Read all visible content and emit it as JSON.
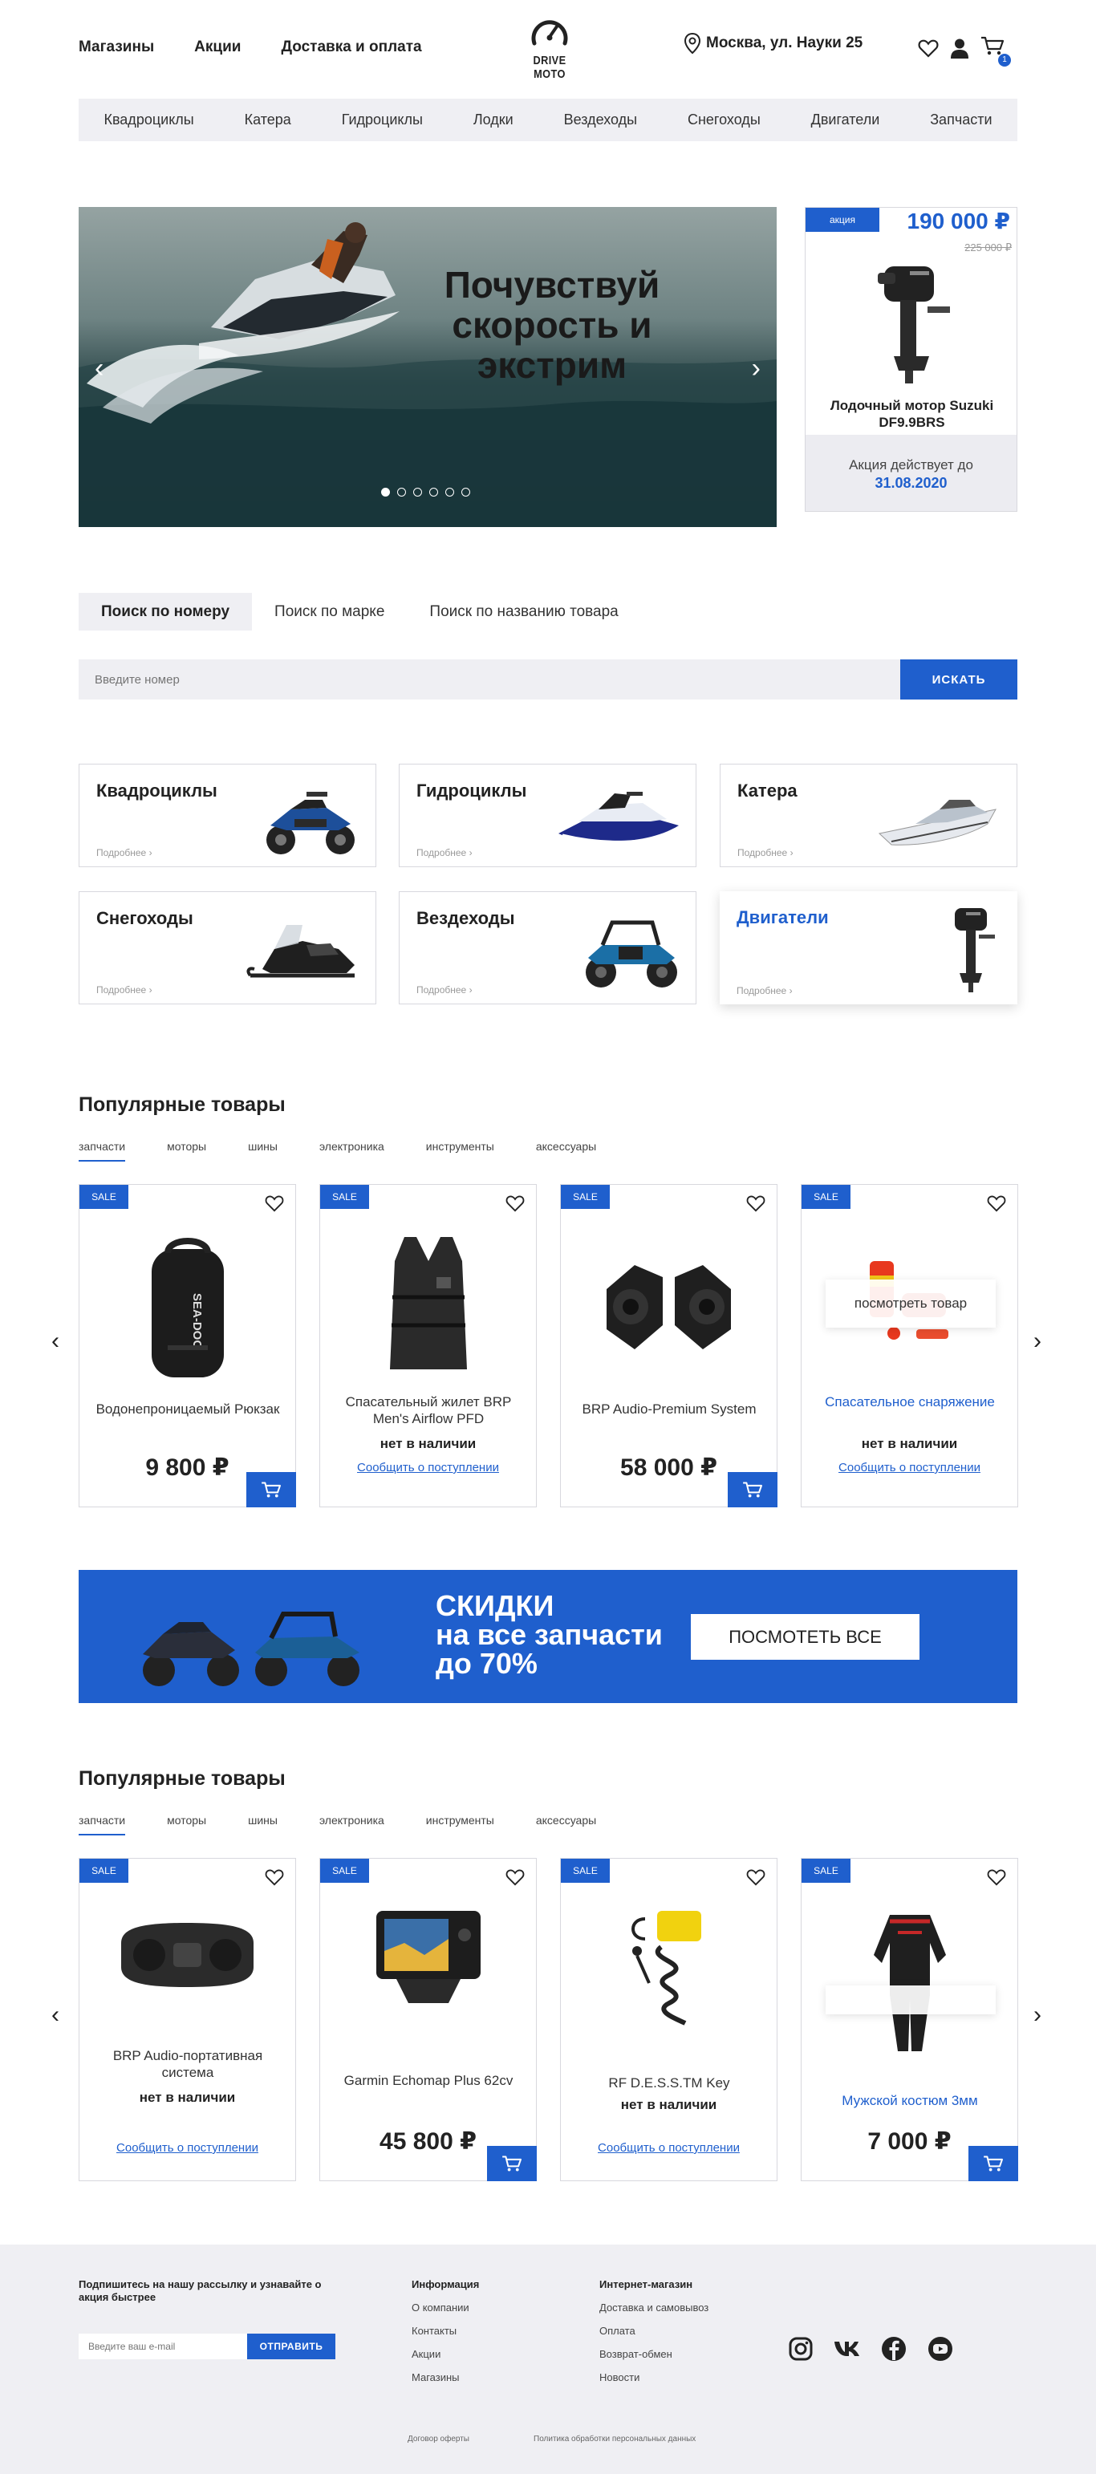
{
  "header": {
    "nav": [
      "Магазины",
      "Акции",
      "Доставка и оплата"
    ],
    "logo_text": "DRIVE MOTO",
    "address": "Москва, ул. Науки 25",
    "cart_count": "1"
  },
  "categories_bar": [
    "Квадроциклы",
    "Катера",
    "Гидроциклы",
    "Лодки",
    "Вездеходы",
    "Снегоходы",
    "Двигатели",
    "Запчасти"
  ],
  "hero": {
    "title_line1": "Почувствуй",
    "title_line2": "скорость и",
    "title_line3": "экстрим",
    "slides": 6,
    "active_slide": 1
  },
  "promo": {
    "badge": "акция",
    "price": "190 000 ₽",
    "old_price": "225 000 ₽",
    "name": "Лодочный мотор Suzuki DF9.9BRS",
    "valid_label": "Акция действует до",
    "valid_date": "31.08.2020"
  },
  "search": {
    "tabs": [
      "Поиск по номеру",
      "Поиск по марке",
      "Поиск по названию товара"
    ],
    "active_tab": 0,
    "placeholder": "Введите номер",
    "button": "ИСКАТЬ"
  },
  "category_cards": [
    {
      "name": "Квадроциклы",
      "more": "Подробнее",
      "highlighted": false,
      "icon": "atv-icon"
    },
    {
      "name": "Гидроциклы",
      "more": "Подробнее",
      "highlighted": false,
      "icon": "jetski-icon"
    },
    {
      "name": "Катера",
      "more": "Подробнее",
      "highlighted": false,
      "icon": "boat-icon"
    },
    {
      "name": "Снегоходы",
      "more": "Подробнее",
      "highlighted": false,
      "icon": "snowmobile-icon"
    },
    {
      "name": "Вездеходы",
      "more": "Подробнее",
      "highlighted": false,
      "icon": "buggy-icon"
    },
    {
      "name": "Двигатели",
      "more": "Подробнее",
      "highlighted": true,
      "icon": "outboard-motor-icon"
    }
  ],
  "popular1": {
    "title": "Популярные товары",
    "tabs": [
      "запчасти",
      "моторы",
      "шины",
      "электроника",
      "инструменты",
      "аксессуары"
    ],
    "active_tab": 0,
    "products": [
      {
        "sale": "SALE",
        "name": "Водонепроницаемый Рюкзак",
        "price": "9 800 ₽",
        "availability": "",
        "notify": "",
        "overlay": "",
        "icon": "backpack-icon"
      },
      {
        "sale": "SALE",
        "name": "Спасательный жилет BRP Men's Airflow PFD",
        "price": "",
        "availability": "нет в наличии",
        "notify": "Сообщить о поступлении",
        "overlay": "",
        "icon": "vest-icon"
      },
      {
        "sale": "SALE",
        "name": "BRP Audio-Premium System",
        "price": "58 000 ₽",
        "availability": "",
        "notify": "",
        "overlay": "",
        "icon": "speakers-icon"
      },
      {
        "sale": "SALE",
        "name": "Спасательное снаряжение",
        "price": "",
        "availability": "нет в наличии",
        "notify": "Сообщить о поступлении",
        "overlay": "посмотреть товар",
        "icon": "rescue-kit-icon"
      }
    ]
  },
  "banner": {
    "line1": "СКИДКИ",
    "line2": "на все запчасти",
    "line3": "до 70%",
    "button": "ПОСМОТЕТЬ ВСЕ"
  },
  "popular2": {
    "title": "Популярные товары",
    "tabs": [
      "запчасти",
      "моторы",
      "шины",
      "электроника",
      "инструменты",
      "аксессуары"
    ],
    "active_tab": 0,
    "products": [
      {
        "sale": "SALE",
        "name": "BRP Audio-портативная система",
        "price": "",
        "availability": "нет в наличии",
        "notify": "Сообщить о поступлении",
        "overlay": "",
        "icon": "portable-speaker-icon"
      },
      {
        "sale": "SALE",
        "name": "Garmin Echomap Plus 62cv",
        "price": "45 800 ₽",
        "availability": "",
        "notify": "",
        "overlay": "",
        "icon": "echomap-icon"
      },
      {
        "sale": "SALE",
        "name": "RF D.E.S.S.TM Key",
        "price": "",
        "availability": "нет в наличии",
        "notify": "Сообщить о поступлении",
        "overlay": "",
        "icon": "key-lanyard-icon"
      },
      {
        "sale": "SALE",
        "name": "Мужской костюм 3мм",
        "price": "7 000 ₽",
        "availability": "",
        "notify": "",
        "overlay": "",
        "icon": "wetsuit-icon"
      }
    ]
  },
  "footer": {
    "subscribe_text": "Подпишитесь на нашу рассылку и узнавайте о акция быстрее",
    "email_placeholder": "Введите ваш e-mail",
    "send_button": "ОТПРАВИТЬ",
    "info_title": "Информация",
    "info_links": [
      "О компании",
      "Контакты",
      "Акции",
      "Магазины"
    ],
    "shop_title": "Интернет-магазин",
    "shop_links": [
      "Доставка и самовывоз",
      "Оплата",
      "Возврат-обмен",
      "Новости"
    ],
    "social": [
      "instagram-icon",
      "vk-icon",
      "facebook-icon",
      "youtube-icon"
    ],
    "legal1": "Договор оферты",
    "legal2": "Политика обработки персональных данных"
  },
  "colors": {
    "accent": "#1f5fcd",
    "light_bg": "#efeff3",
    "border": "#d8d8de",
    "text": "#222222"
  }
}
